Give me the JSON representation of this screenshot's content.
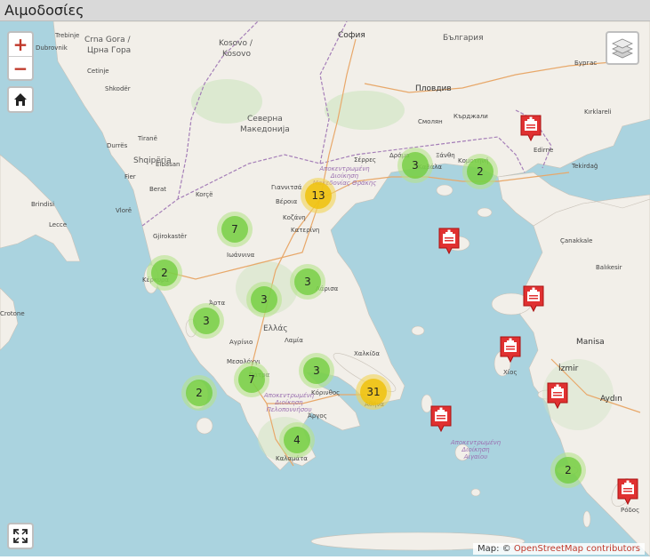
{
  "title": "Αιμοδοσίες",
  "map": {
    "zoom_in_label": "+",
    "zoom_out_label": "−",
    "attribution_prefix": "Map: ©",
    "attribution_link": "OpenStreetMap contributors",
    "colors": {
      "sea": "#aad3df",
      "land": "#f2efe9",
      "cluster_small": "#6ecc39",
      "cluster_medium": "#f0c20c",
      "marker": "#e03131"
    },
    "clusters": [
      {
        "count": "13",
        "size": "medium"
      },
      {
        "count": "3",
        "size": "small"
      },
      {
        "count": "2",
        "size": "small"
      },
      {
        "count": "7",
        "size": "small"
      },
      {
        "count": "2",
        "size": "small"
      },
      {
        "count": "3",
        "size": "small"
      },
      {
        "count": "3",
        "size": "small"
      },
      {
        "count": "3",
        "size": "small"
      },
      {
        "count": "3",
        "size": "small"
      },
      {
        "count": "7",
        "size": "small"
      },
      {
        "count": "2",
        "size": "small"
      },
      {
        "count": "31",
        "size": "medium"
      },
      {
        "count": "4",
        "size": "small"
      },
      {
        "count": "2",
        "size": "small"
      }
    ],
    "markers": [
      "hospital-marker",
      "hospital-marker",
      "hospital-marker",
      "hospital-marker",
      "hospital-marker",
      "hospital-marker",
      "hospital-marker"
    ],
    "labels": {
      "trebinje": "Trebinje",
      "dubrovnik": "Dubrovnik",
      "crna_gora": "Crna Gora /",
      "crna_gora2": "Црна Гора",
      "cetinje": "Cetinje",
      "shkoder": "Shkodër",
      "kosovo": "Kosovo /",
      "kosovo2": "Kosovo",
      "sofia": "София",
      "bulgaria": "България",
      "burgas": "Бургас",
      "plovdiv": "Пловдив",
      "smolyan": "Смолян",
      "kardzhali": "Кърджали",
      "severna": "Северна",
      "makedonija": "Македонија",
      "tirane": "Tiranë",
      "shqiperia": "Shqipëria",
      "durres": "Durrës",
      "brindisi": "Brindisi",
      "lecce": "Lecce",
      "crotone": "Crotone",
      "edirne": "Edirne",
      "tekirdag": "Tekirdağ",
      "canakkale": "Çanakkale",
      "balikesir": "Balıkesir",
      "manisa": "Manisa",
      "izmir": "İzmir",
      "aydin": "Aydın",
      "serres": "Σέρρες",
      "drama": "Δράμα",
      "kozani": "Κοζάνη",
      "larisa": "Λάρισα",
      "arta": "Άρτα",
      "ellada": "Ελλάς",
      "lamia": "Λαμία",
      "chalkida": "Χαλκίδα",
      "athina": "Αθήνα",
      "korinthos": "Κόρινθος",
      "argos": "Άργος",
      "kalamata": "Καλαμάτα",
      "mesologgi": "Μεσολόγγι",
      "agrinio": "Αγρίνιο",
      "patra": "Πάτρα",
      "veroia": "Βέροια",
      "giannitsa": "Γιαννιτσά",
      "katerini": "Κατερίνη",
      "chios": "Χίος",
      "rodos": "Ρόδος",
      "ioannina": "Ιωάννινα",
      "kerkyra": "Κέρκυρα",
      "gjirokaster": "Gjirokastër",
      "vlore": "Vlorë",
      "berat": "Berat",
      "korce": "Korçë",
      "elbasan": "Elbasan",
      "fier": "Fier",
      "kavala": "Καβάλα",
      "xanthi": "Ξάνθη",
      "komotini": "Κομοτηνή",
      "kirklareli": "Kırklareli",
      "dyt_makedonia": "Αποκεντρωμένη Διοίκηση Μακεδονίας Θράκης",
      "peloponnisou": "Αποκεντρωμένη Διοίκηση Πελοποννήσου",
      "aigaiou": "Αποκεντρωμένη Διοίκηση Αιγαίου"
    }
  }
}
